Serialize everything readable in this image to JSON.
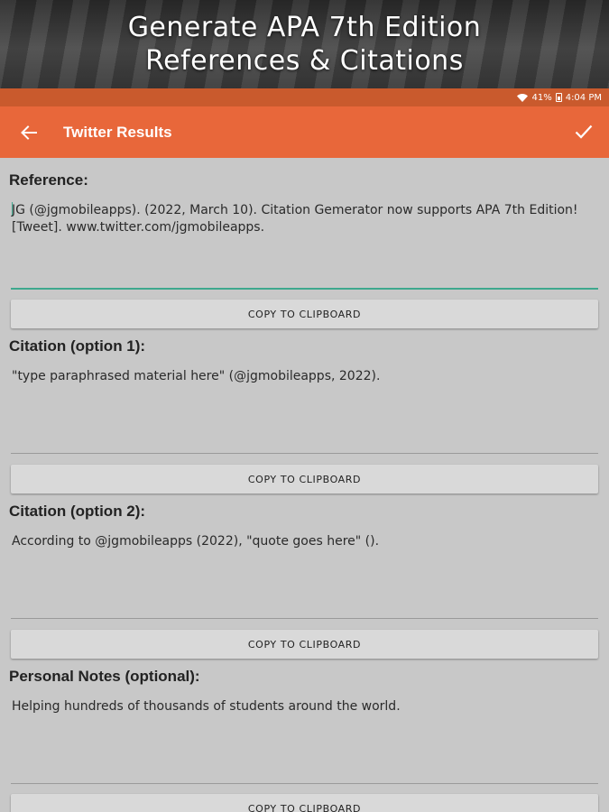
{
  "banner": {
    "line1": "Generate APA 7th Edition",
    "line2": "References & Citations"
  },
  "status_bar": {
    "battery": "41%",
    "time": "4:04 PM",
    "icons": [
      "wifi-icon",
      "battery-icon"
    ]
  },
  "app_bar": {
    "title": "Twitter Results",
    "back_icon": "arrow-left-icon",
    "confirm_icon": "checkmark-icon",
    "color": "#e8673a"
  },
  "sections": [
    {
      "heading": "Reference:",
      "text_line1": "JG (@jgmobileapps). (2022, March 10). Citation Gemerator now supports APA 7th Edition!",
      "text_line2": "[Tweet]. www.twitter.com/jgmobileapps.",
      "button": "COPY TO CLIPBOARD"
    },
    {
      "heading": "Citation (option 1):",
      "text": "\"type paraphrased material here\" (@jgmobileapps, 2022).",
      "button": "COPY TO CLIPBOARD"
    },
    {
      "heading": "Citation (option 2):",
      "text": "According to @jgmobileapps (2022), \"quote goes here\" ().",
      "button": "COPY TO CLIPBOARD"
    },
    {
      "heading": "Personal Notes (optional):",
      "text": "Helping hundreds of thousands of students around the world.",
      "button": "COPY TO CLIPBOARD"
    }
  ],
  "colors": {
    "accent": "#e8673a",
    "status_bar": "#c95a2d",
    "field_focus": "#3ea88e",
    "background": "#c8c8c8"
  }
}
